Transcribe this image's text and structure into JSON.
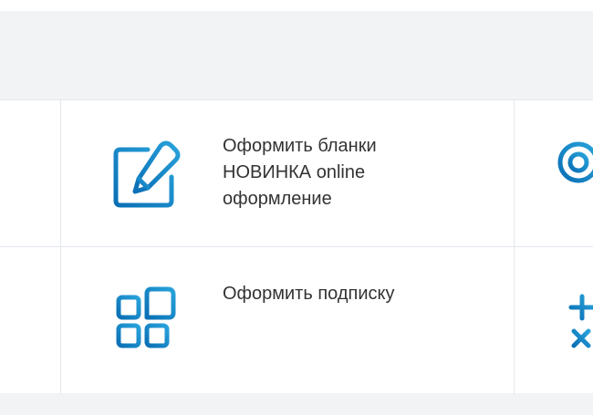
{
  "colors": {
    "accent_dark": "#0a6fb5",
    "accent_light": "#29a3db",
    "text": "#333333",
    "divider": "#e3e8ec"
  },
  "services": [
    {
      "label": "Оформить бланки\nНОВИНКА online\nоформление",
      "icon": "edit-form-icon"
    },
    {
      "label": "Оформить подписку",
      "icon": "subscription-grid-icon"
    }
  ],
  "edge_icons": [
    "stamp-icon",
    "plus-cross-icon"
  ]
}
